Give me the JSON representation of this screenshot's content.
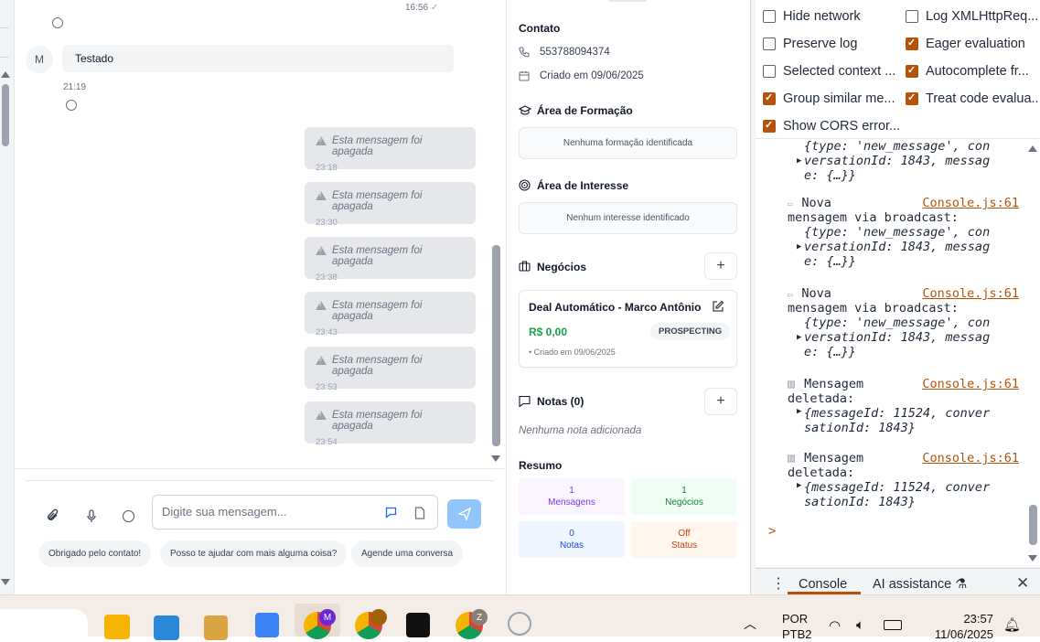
{
  "chat": {
    "top_time": "16:56",
    "contact_initial": "M",
    "incoming_message": "Testado",
    "incoming_time": "21:19",
    "deleted_messages": [
      {
        "text": "Esta mensagem foi apagada",
        "time": "23:18"
      },
      {
        "text": "Esta mensagem foi apagada",
        "time": "23:30"
      },
      {
        "text": "Esta mensagem foi apagada",
        "time": "23:38"
      },
      {
        "text": "Esta mensagem foi apagada",
        "time": "23:43"
      },
      {
        "text": "Esta mensagem foi apagada",
        "time": "23:53"
      },
      {
        "text": "Esta mensagem foi apagada",
        "time": "23:54"
      }
    ],
    "input_placeholder": "Digite sua mensagem...",
    "quick_replies": [
      "Obrigado pelo contato!",
      "Posso te ajudar com mais alguma coisa?",
      "Agende uma conversa"
    ]
  },
  "panel": {
    "contact_title": "Contato",
    "phone": "553788094374",
    "created": "Criado em 09/06/2025",
    "formation_title": "Área de Formação",
    "formation_empty": "Nenhuma formação identificada",
    "interest_title": "Área de Interesse",
    "interest_empty": "Nenhum interesse identificado",
    "deals_title": "Negócios",
    "deal": {
      "name": "Deal Automático - Marco Antônio",
      "value": "R$ 0,00",
      "stage": "PROSPECTING",
      "created": "• Criado em 09/06/2025"
    },
    "notes_title": "Notas (0)",
    "notes_empty": "Nenhuma nota adicionada",
    "summary_title": "Resumo",
    "stats": [
      {
        "value": "1",
        "label": "Mensagens",
        "color": "#7c3aed",
        "bg": "#faf5ff"
      },
      {
        "value": "1",
        "label": "Negócios",
        "color": "#15803d",
        "bg": "#f0fdf4"
      },
      {
        "value": "0",
        "label": "Notas",
        "color": "#1d4ed8",
        "bg": "#eff6ff"
      },
      {
        "value": "Off",
        "label": "Status",
        "color": "#c2410c",
        "bg": "#fff7ed"
      }
    ]
  },
  "devtools": {
    "settings": [
      {
        "label": "Hide network",
        "checked": false
      },
      {
        "label": "Log XMLHttpReq...",
        "checked": false
      },
      {
        "label": "Preserve log",
        "checked": false
      },
      {
        "label": "Eager evaluation",
        "checked": true
      },
      {
        "label": "Selected context ...",
        "checked": false
      },
      {
        "label": "Autocomplete fr...",
        "checked": true
      },
      {
        "label": "Group similar me...",
        "checked": true
      },
      {
        "label": "Treat code evalua...",
        "checked": true
      },
      {
        "label": "Show CORS error...",
        "checked": true
      }
    ],
    "source": "Console.js:61",
    "broadcast_label_1": "Nova",
    "broadcast_label_2": "mensagem via broadcast:",
    "deleted_label_1": "Mensagem",
    "deleted_label_2": "deletada:",
    "obj_type_line": "{type: 'new_message', con",
    "obj_conv_line": "versationId: 1843, messag",
    "obj_end_line": "e: {…}}",
    "del_line_1": "{messageId: 11524, conver",
    "del_line_2": "sationId: 1843}",
    "prompt": ">",
    "tab_console": "Console",
    "tab_ai": "AI assistance"
  },
  "taskbar": {
    "lang_1": "POR",
    "lang_2": "PTB2",
    "time": "23:57",
    "date": "11/06/2025",
    "chrome_badge_m": "M",
    "chrome_badge_z": "Z"
  }
}
